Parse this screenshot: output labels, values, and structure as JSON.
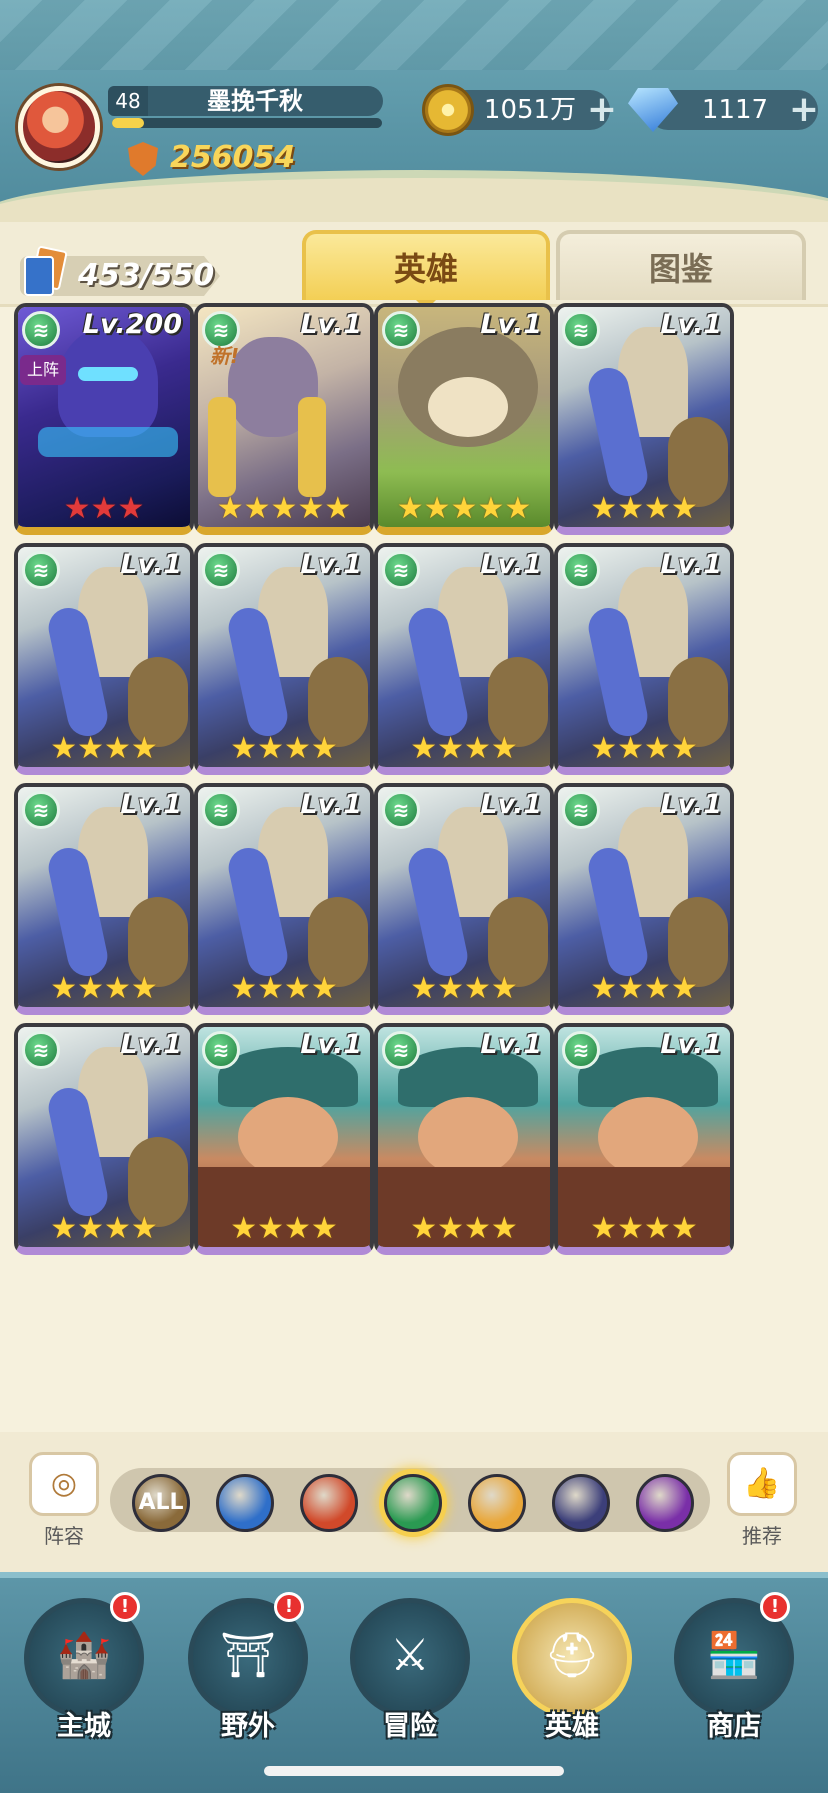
{
  "player": {
    "level": "48",
    "name": "墨挽千秋",
    "power": "256054",
    "exp_fraction": 0.12
  },
  "resources": {
    "gold": "1051万",
    "gems": "1117",
    "plus_symbol": "+"
  },
  "hero_count": "453/550",
  "tabs": [
    {
      "label": "英雄",
      "active": true
    },
    {
      "label": "图鉴",
      "active": false
    }
  ],
  "new_badge": "新!",
  "deploy_badge": "上阵",
  "faction_glyph": "≋",
  "star_glyph": "★",
  "heroes": [
    {
      "level": "Lv.200",
      "art": "assassin",
      "stars": 3,
      "star_color": "red",
      "base": "gold",
      "deployed": true
    },
    {
      "level": "Lv.1",
      "art": "tribal",
      "stars": 5,
      "star_color": "gold",
      "base": "gold",
      "new": true
    },
    {
      "level": "Lv.1",
      "art": "cat",
      "stars": 5,
      "star_color": "gold",
      "base": "gold"
    },
    {
      "level": "Lv.1",
      "art": "knight",
      "stars": 4,
      "star_color": "gold",
      "base": "purple"
    },
    {
      "level": "Lv.1",
      "art": "knight",
      "stars": 4,
      "star_color": "gold",
      "base": "purple"
    },
    {
      "level": "Lv.1",
      "art": "knight",
      "stars": 4,
      "star_color": "gold",
      "base": "purple"
    },
    {
      "level": "Lv.1",
      "art": "knight",
      "stars": 4,
      "star_color": "gold",
      "base": "purple"
    },
    {
      "level": "Lv.1",
      "art": "knight",
      "stars": 4,
      "star_color": "gold",
      "base": "purple"
    },
    {
      "level": "Lv.1",
      "art": "knight",
      "stars": 4,
      "star_color": "gold",
      "base": "purple"
    },
    {
      "level": "Lv.1",
      "art": "knight",
      "stars": 4,
      "star_color": "gold",
      "base": "purple"
    },
    {
      "level": "Lv.1",
      "art": "knight",
      "stars": 4,
      "star_color": "gold",
      "base": "purple"
    },
    {
      "level": "Lv.1",
      "art": "knight",
      "stars": 4,
      "star_color": "gold",
      "base": "purple"
    },
    {
      "level": "Lv.1",
      "art": "knight",
      "stars": 4,
      "star_color": "gold",
      "base": "purple"
    },
    {
      "level": "Lv.1",
      "art": "mouse",
      "stars": 4,
      "star_color": "gold",
      "base": "purple"
    },
    {
      "level": "Lv.1",
      "art": "mouse",
      "stars": 4,
      "star_color": "gold",
      "base": "purple"
    },
    {
      "level": "Lv.1",
      "art": "mouse",
      "stars": 4,
      "star_color": "gold",
      "base": "purple"
    }
  ],
  "filter": {
    "lineup_label": "阵容",
    "recommend_label": "推荐",
    "factions": [
      {
        "name": "all",
        "label": "ALL",
        "color": "#8a6a3a"
      },
      {
        "name": "water",
        "label": "",
        "color": "#2f6fc9"
      },
      {
        "name": "fire",
        "label": "",
        "color": "#d1492a"
      },
      {
        "name": "wind",
        "label": "",
        "color": "#2a9a52",
        "active": true
      },
      {
        "name": "light",
        "label": "",
        "color": "#e9a73a"
      },
      {
        "name": "dark",
        "label": "",
        "color": "#3c3f7a"
      },
      {
        "name": "arcane",
        "label": "",
        "color": "#7a2fa8"
      }
    ]
  },
  "nav": [
    {
      "label": "主城",
      "icon": "castle-icon",
      "alert": true,
      "active": false
    },
    {
      "label": "野外",
      "icon": "portal-icon",
      "alert": true,
      "active": false
    },
    {
      "label": "冒险",
      "icon": "sword-icon",
      "alert": false,
      "active": false
    },
    {
      "label": "英雄",
      "icon": "helmet-icon",
      "alert": false,
      "active": true
    },
    {
      "label": "商店",
      "icon": "shop-icon",
      "alert": true,
      "active": false
    }
  ],
  "alert_glyph": "!"
}
